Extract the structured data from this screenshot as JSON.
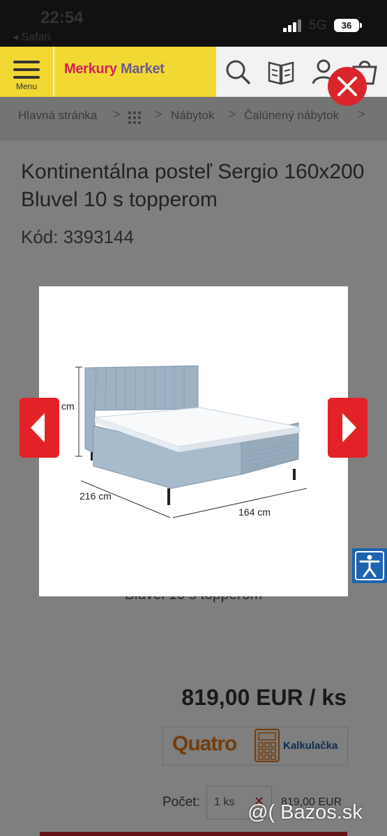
{
  "status": {
    "time": "22:54",
    "back_app": "◂ Safari",
    "network": "5G",
    "battery": "36"
  },
  "header": {
    "menu_label": "Menu",
    "logo_part1": "Merkury",
    "logo_part2": "Market",
    "icons": [
      "search-icon",
      "catalog-icon",
      "user-icon",
      "cart-icon"
    ]
  },
  "breadcrumb": {
    "items": [
      "Hlavná stránka",
      "Nábytok",
      "Čalúnený nábytok"
    ],
    "separator": ">"
  },
  "product": {
    "title": "Kontinentálna posteľ Sergio 160x200 Bluvel 10 s topperom",
    "code": "Kód: 3393144",
    "subtitle_partial": "Bluvel 10 s topperom",
    "price": "819,00 EUR / ks",
    "financing_brand": "Quatro",
    "financing_link": "Kalkulačka",
    "quantity_label": "Počet:",
    "quantity_value": "1 ks",
    "line_total": "819,00 EUR"
  },
  "lightbox": {
    "dim_height": "cm",
    "dim_length": "216 cm",
    "dim_width": "164 cm"
  },
  "watermark": "@( Bazos.sk",
  "colors": {
    "brand_yellow": "#f1d833",
    "brand_red": "#e32227",
    "accessibility_blue": "#1e63b0",
    "bed_fabric": "#9eb2c4"
  }
}
